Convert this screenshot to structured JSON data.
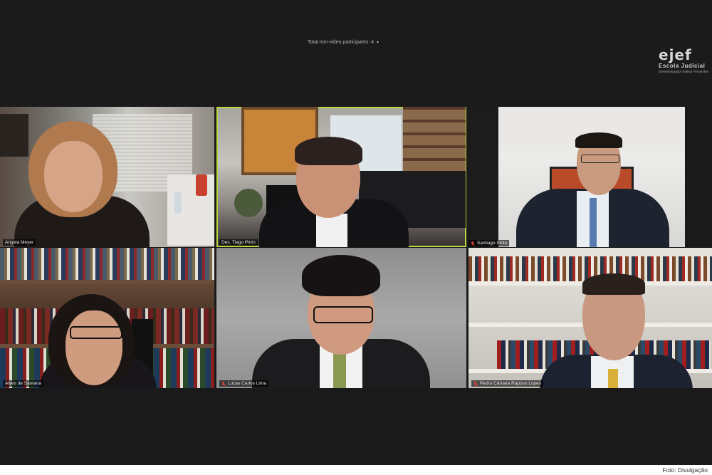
{
  "top_bar": {
    "non_video_participants": "Total non-video participants: 4",
    "caret": "▾"
  },
  "logo": {
    "mark": "ejef",
    "line1": "Escola Judicial",
    "line2": "Desembargador Edésio Fernandes"
  },
  "participants": [
    {
      "name": "Angela Meyer",
      "muted": false,
      "active": false
    },
    {
      "name": "Des. Tiago Pinto",
      "muted": false,
      "active": true
    },
    {
      "name": "Santiago Pinto",
      "muted": true,
      "active": false
    },
    {
      "name": "Alves de Santana",
      "muted": false,
      "active": false
    },
    {
      "name": "Lucas Carlos Lima",
      "muted": true,
      "active": false
    },
    {
      "name": "Pedro Câmara Raposo Lopes",
      "muted": true,
      "active": false
    }
  ],
  "photo_credit": "Foto: Divulgação",
  "colors": {
    "active_speaker_border": "#b8d640",
    "muted_icon": "#e0403a",
    "background": "#1a1a1a"
  }
}
